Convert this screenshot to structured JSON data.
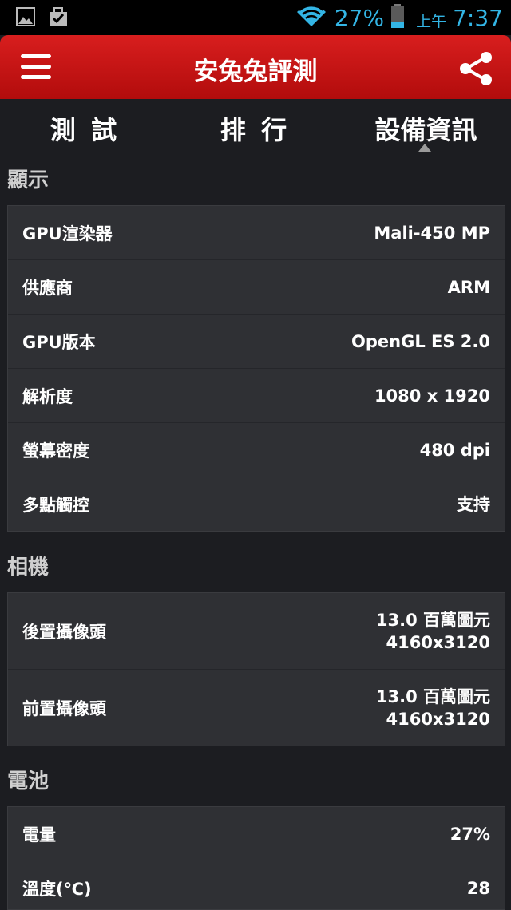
{
  "status_bar": {
    "battery_percent": "27%",
    "am_pm": "上午",
    "time": "7:37"
  },
  "app_bar": {
    "title": "安兔兔評測"
  },
  "tabs": [
    {
      "label": "測 試"
    },
    {
      "label": "排 行"
    },
    {
      "label": "設備資訊"
    }
  ],
  "sections": {
    "display": {
      "title": "顯示",
      "rows": [
        {
          "label": "GPU渲染器",
          "value": "Mali-450 MP"
        },
        {
          "label": "供應商",
          "value": "ARM"
        },
        {
          "label": "GPU版本",
          "value": "OpenGL ES 2.0"
        },
        {
          "label": "解析度",
          "value": "1080 x 1920"
        },
        {
          "label": "螢幕密度",
          "value": "480 dpi"
        },
        {
          "label": "多點觸控",
          "value": "支持"
        }
      ]
    },
    "camera": {
      "title": "相機",
      "rows": [
        {
          "label": "後置攝像頭",
          "value_line1": "13.0 百萬圖元",
          "value_line2": "4160x3120"
        },
        {
          "label": "前置攝像頭",
          "value_line1": "13.0 百萬圖元",
          "value_line2": "4160x3120"
        }
      ]
    },
    "battery": {
      "title": "電池",
      "rows": [
        {
          "label": "電量",
          "value": "27%"
        },
        {
          "label": "溫度(℃)",
          "value": "28"
        }
      ]
    }
  }
}
